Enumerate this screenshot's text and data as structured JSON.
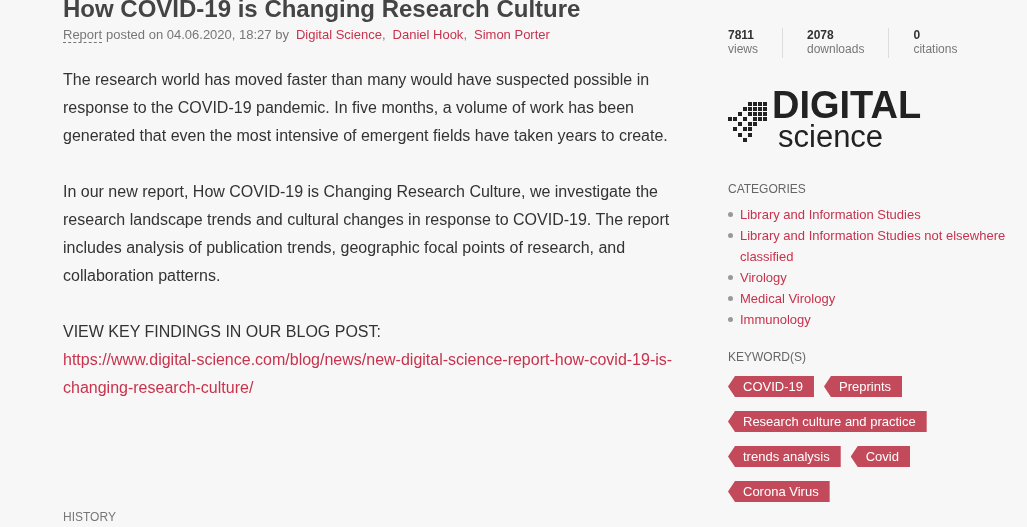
{
  "article": {
    "title": "How COVID-19 is Changing Research Culture",
    "meta": {
      "type": "Report",
      "posted": "posted on 04.06.2020, 18:27 by",
      "authors": [
        "Digital Science",
        "Daniel Hook",
        "Simon Porter"
      ],
      "separator": ","
    },
    "paragraphs": [
      "The research world has moved faster than many would have suspected possible in response to the COVID-19 pandemic. In five months, a volume of work has been generated that even the most intensive of emergent fields have taken years to create.",
      "In our new report, How COVID-19 is Changing Research Culture, we investigate the research landscape trends and cultural changes in response to COVID-19. The report includes analysis of publication trends, geographic focal points of research, and collaboration patterns."
    ],
    "blog_label": "VIEW KEY FINDINGS IN OUR BLOG POST:",
    "blog_link": "https://www.digital-science.com/blog/news/new-digital-science-report-how-covid-19-is-changing-research-culture/",
    "history_heading": "HISTORY"
  },
  "sidebar": {
    "stats": [
      {
        "value": "7811",
        "label": "views"
      },
      {
        "value": "2078",
        "label": "downloads"
      },
      {
        "value": "0",
        "label": "citations"
      }
    ],
    "logo": {
      "line1": "DIGITAL",
      "line2": "science"
    },
    "categories_heading": "CATEGORIES",
    "categories": [
      "Library and Information Studies",
      "Library and Information Studies not elsewhere classified",
      "Virology",
      "Medical Virology",
      "Immunology"
    ],
    "keywords_heading": "KEYWORD(S)",
    "keyword_rows": [
      [
        "COVID-19",
        "Preprints"
      ],
      [
        "Research culture and practice"
      ],
      [
        "trends analysis",
        "Covid"
      ],
      [
        "Corona Virus"
      ]
    ]
  }
}
